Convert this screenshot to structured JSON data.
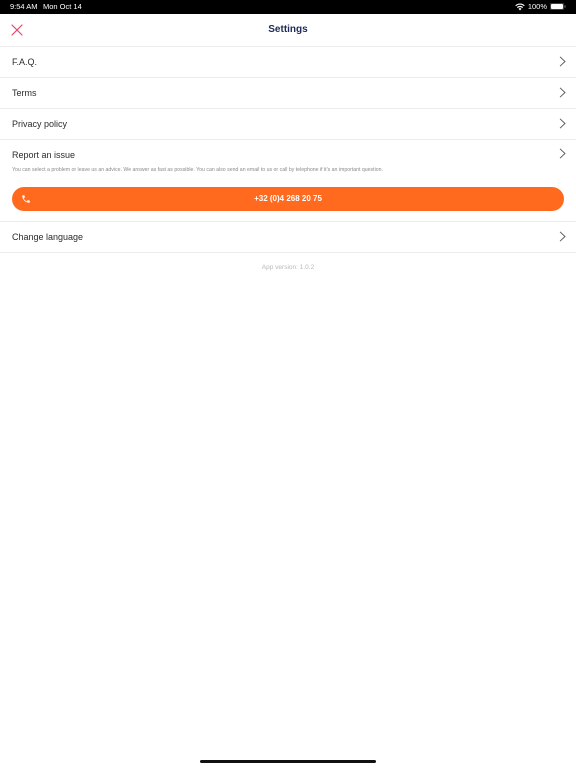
{
  "status_bar": {
    "time": "9:54 AM",
    "date": "Mon Oct 14",
    "battery": "100%",
    "wifi_icon": "wifi-icon",
    "battery_icon": "battery-icon"
  },
  "header": {
    "title": "Settings",
    "close_icon": "close-icon",
    "accent_color": "#e8456b",
    "title_color": "#1e2a57"
  },
  "menu": {
    "faq": "F.A.Q.",
    "terms": "Terms",
    "privacy": "Privacy policy",
    "change_language": "Change language"
  },
  "report": {
    "title": "Report an issue",
    "description": "You can select a problem or leave us an advice. We answer as fast as possible. You can also send an email to us or call by telephone if it's an important question.",
    "phone": "+32 (0)4 268 20 75",
    "phone_icon": "phone-icon",
    "button_color": "#ff6a1f"
  },
  "footer": {
    "app_version": "App version: 1.0.2"
  }
}
